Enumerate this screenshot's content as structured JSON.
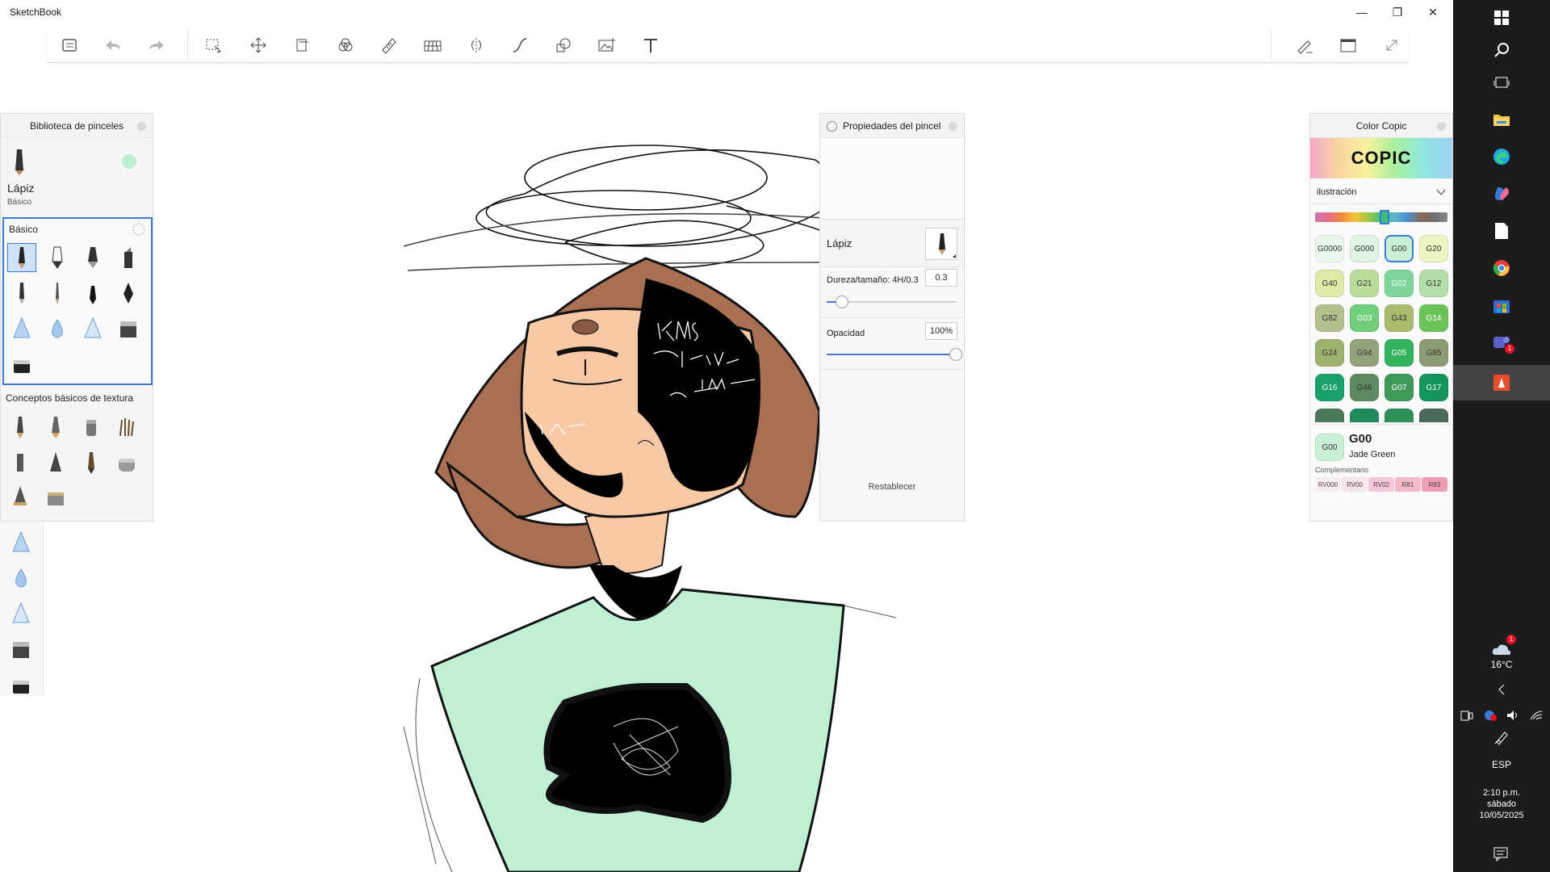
{
  "window": {
    "title": "SketchBook",
    "minimize": "—",
    "maximize": "❐",
    "close": "✕"
  },
  "toolbar": {
    "tools": [
      "brush-list",
      "undo",
      "redo",
      "select",
      "transform",
      "layer-flip",
      "color-mix",
      "ruler",
      "perspective",
      "symmetry",
      "curve",
      "shapes",
      "import-image",
      "text"
    ],
    "right_tools": [
      "pencil-stroke",
      "window-mode",
      "fullscreen"
    ]
  },
  "brush_library": {
    "title": "Biblioteca de pinceles",
    "current_name": "Lápiz",
    "current_set": "Básico",
    "current_color": "#bdf0cf",
    "sets": [
      {
        "name": "Básico"
      },
      {
        "name": "Conceptos básicos de textura"
      }
    ]
  },
  "brush_props": {
    "title": "Propiedades del pincel",
    "brush_name": "Lápiz",
    "hardness_label": "Dureza/tamaño: 4H/0.3",
    "hardness_value": "0.3",
    "hardness_level": 0.12,
    "opacity_label": "Opacidad",
    "opacity_value": "100%",
    "opacity_level": 1.0,
    "reset_label": "Restablecer"
  },
  "copic": {
    "title": "Color Copic",
    "logo": "COPIC",
    "palette": "ilustración",
    "swatches": [
      {
        "code": "G0000",
        "color": "#eaf7ec"
      },
      {
        "code": "G000",
        "color": "#dff4e2"
      },
      {
        "code": "G00",
        "color": "#c9efd6"
      },
      {
        "code": "G20",
        "color": "#eef3c2"
      },
      {
        "code": "G40",
        "color": "#dfe9a8"
      },
      {
        "code": "G21",
        "color": "#b9dc9b"
      },
      {
        "code": "G02",
        "color": "#7dd59a"
      },
      {
        "code": "G12",
        "color": "#b3deaa"
      },
      {
        "code": "G82",
        "color": "#b3c28d"
      },
      {
        "code": "G03",
        "color": "#6fcf7b"
      },
      {
        "code": "G43",
        "color": "#aabb6e"
      },
      {
        "code": "G14",
        "color": "#6cc35a"
      },
      {
        "code": "G24",
        "color": "#9fb36e"
      },
      {
        "code": "G94",
        "color": "#93a27a"
      },
      {
        "code": "G05",
        "color": "#34b35f"
      },
      {
        "code": "G85",
        "color": "#8d9b76"
      },
      {
        "code": "G16",
        "color": "#1aa16a"
      },
      {
        "code": "G46",
        "color": "#5e8a62"
      },
      {
        "code": "G07",
        "color": "#3f9a5a"
      },
      {
        "code": "G17",
        "color": "#14955a"
      }
    ],
    "selected_code": "G00",
    "selected_name": "Jade Green",
    "complementary_label": "Complementario",
    "complementary": [
      {
        "code": "RV000",
        "color": "#fbeef3"
      },
      {
        "code": "RV00",
        "color": "#f8e4ec"
      },
      {
        "code": "RV02",
        "color": "#f6c6dc"
      },
      {
        "code": "R81",
        "color": "#f3b9c7"
      },
      {
        "code": "R83",
        "color": "#ef9db3"
      }
    ]
  },
  "taskbar": {
    "weather_temp": "16°C",
    "weather_badge": "1",
    "teams_badge": "1",
    "lang": "ESP",
    "time": "2:10 p.m.",
    "day": "sábado",
    "date": "10/05/2025"
  },
  "colors": {
    "shirt": "#bff0d4",
    "skin": "#f9c8a5",
    "hair": "#a86f52",
    "ink": "#000000",
    "selection_blue": "#3a7bd5"
  }
}
